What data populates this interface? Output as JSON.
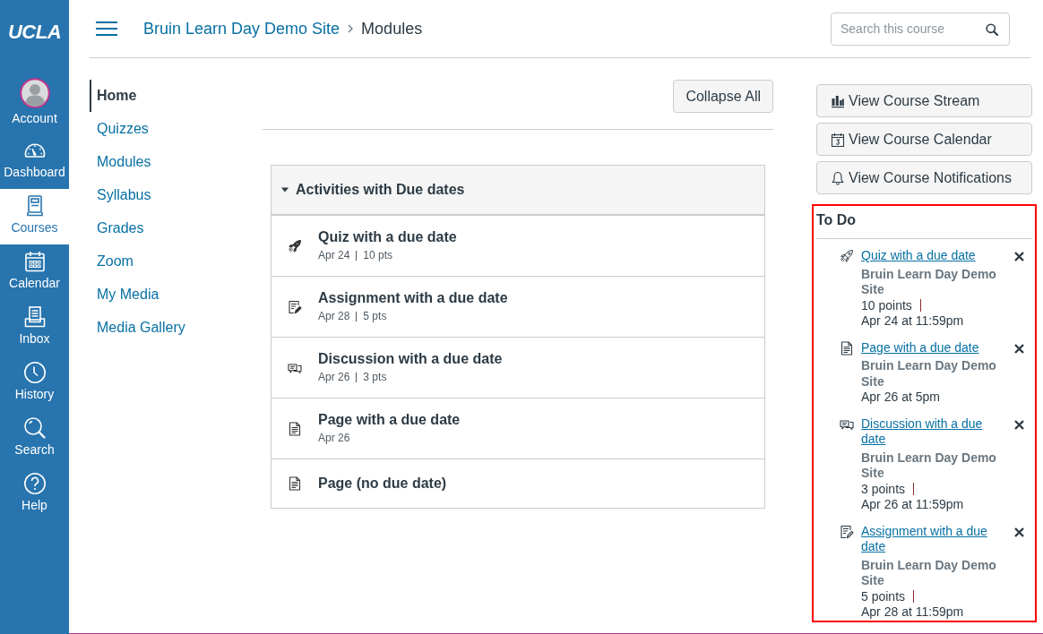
{
  "global_nav": {
    "logo": "UCLA",
    "items": [
      {
        "kind": "account",
        "label": "Account",
        "selected": false
      },
      {
        "kind": "dashboard",
        "label": "Dashboard",
        "selected": false
      },
      {
        "kind": "courses",
        "label": "Courses",
        "selected": true
      },
      {
        "kind": "calendar",
        "label": "Calendar",
        "selected": false
      },
      {
        "kind": "inbox",
        "label": "Inbox",
        "selected": false
      },
      {
        "kind": "history",
        "label": "History",
        "selected": false
      },
      {
        "kind": "search",
        "label": "Search",
        "selected": false
      },
      {
        "kind": "help",
        "label": "Help",
        "selected": false
      }
    ]
  },
  "header": {
    "breadcrumbs": [
      {
        "kind": "link",
        "label": "Bruin Learn Day Demo Site"
      },
      {
        "kind": "current",
        "label": "Modules"
      }
    ],
    "search": {
      "placeholder": "Search this course"
    }
  },
  "course_nav": {
    "items": [
      {
        "label": "Home",
        "selected": true
      },
      {
        "label": "Quizzes",
        "selected": false
      },
      {
        "label": "Modules",
        "selected": false
      },
      {
        "label": "Syllabus",
        "selected": false
      },
      {
        "label": "Grades",
        "selected": false
      },
      {
        "label": "Zoom",
        "selected": false
      },
      {
        "label": "My Media",
        "selected": false
      },
      {
        "label": "Media Gallery",
        "selected": false
      }
    ]
  },
  "modules": {
    "collapse_button": "Collapse All",
    "module": {
      "title": "Activities with Due dates",
      "expanded": true,
      "items": [
        {
          "kind": "quiz",
          "title": "Quiz with a due date",
          "date": "Apr 24",
          "points": "10 pts"
        },
        {
          "kind": "assignment",
          "title": "Assignment with a due date",
          "date": "Apr 28",
          "points": "5 pts"
        },
        {
          "kind": "discussion",
          "title": "Discussion with a due date",
          "date": "Apr 26",
          "points": "3 pts"
        },
        {
          "kind": "page",
          "title": "Page with a due date",
          "date": "Apr 26"
        },
        {
          "kind": "page",
          "title": "Page (no due date)"
        }
      ]
    }
  },
  "sidebar": {
    "buttons": [
      {
        "kind": "stream",
        "label": "View Course Stream"
      },
      {
        "kind": "calendar",
        "label": "View Course Calendar"
      },
      {
        "kind": "notifications",
        "label": "View Course Notifications"
      }
    ],
    "todo": {
      "title": "To Do",
      "highlighted": true,
      "items": [
        {
          "kind": "quiz",
          "title": "Quiz with a due date",
          "course": "Bruin Learn Day Demo Site",
          "points": "10 points",
          "due": "Apr 24 at 11:59pm"
        },
        {
          "kind": "page",
          "title": "Page with a due date",
          "course": "Bruin Learn Day Demo Site",
          "due": "Apr 26 at 5pm"
        },
        {
          "kind": "discussion",
          "title": "Discussion with a due date",
          "course": "Bruin Learn Day Demo Site",
          "points": "3 points",
          "due": "Apr 26 at 11:59pm"
        },
        {
          "kind": "assignment",
          "title": "Assignment with a due date",
          "course": "Bruin Learn Day Demo Site",
          "points": "5 points",
          "due": "Apr 28 at 11:59pm"
        }
      ]
    }
  }
}
